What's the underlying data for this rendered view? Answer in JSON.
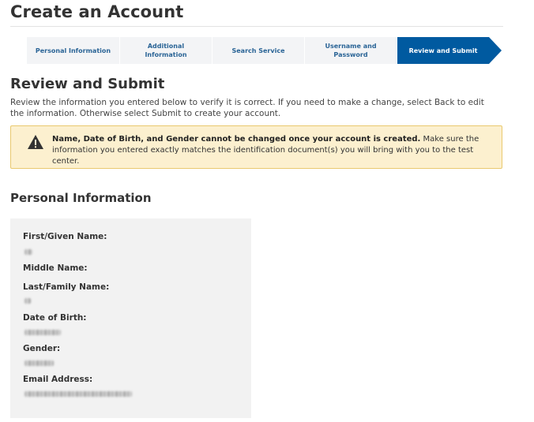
{
  "page": {
    "title": "Create an Account"
  },
  "steps": [
    {
      "label": "Personal Information",
      "active": false
    },
    {
      "label": "Additional Information",
      "active": false
    },
    {
      "label": "Search Service",
      "active": false
    },
    {
      "label": "Username and Password",
      "active": false
    },
    {
      "label": "Review and Submit",
      "active": true
    }
  ],
  "review": {
    "title": "Review and Submit",
    "intro": "Review the information you entered below to verify it is correct. If you need to make a change, select Back to edit the information. Otherwise select Submit to create your account."
  },
  "warning": {
    "icon": "warning-triangle-icon",
    "bold": "Name, Date of Birth, and Gender cannot be changed once your account is created.",
    "text": " Make sure the information you entered exactly matches the identification document(s) you will bring with you to the test center."
  },
  "personal": {
    "title": "Personal Information",
    "fields": {
      "first_name": "First/Given Name:",
      "middle_name": "Middle Name:",
      "last_name": "Last/Family Name:",
      "dob": "Date of Birth:",
      "gender": "Gender:",
      "email": "Email Address:"
    }
  },
  "colors": {
    "active_step": "#005aa0",
    "step_text": "#2a6496",
    "warning_bg": "#fcf0cf",
    "warning_border": "#e9c96f",
    "panel_bg": "#f2f2f2"
  }
}
